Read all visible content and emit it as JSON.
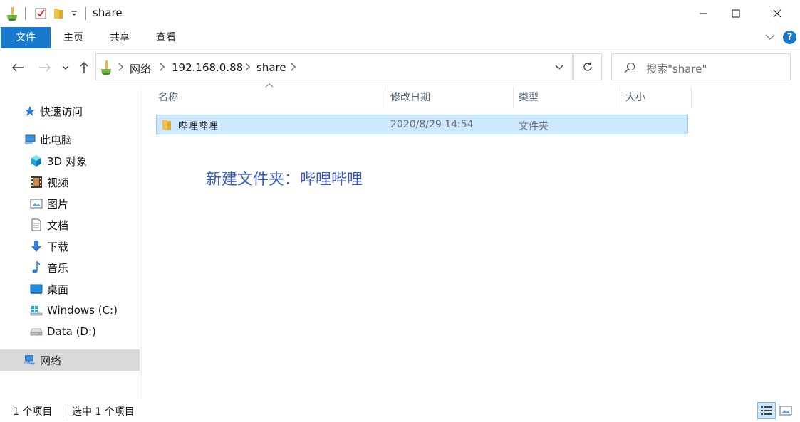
{
  "window": {
    "title": "share",
    "controls": [
      "minimize-icon",
      "maximize-icon",
      "close-icon"
    ]
  },
  "quick_access_toolbar": {
    "icons": [
      "properties-icon",
      "new-folder-icon",
      "customize-dropdown-icon"
    ]
  },
  "ribbon": {
    "tabs": [
      {
        "label": "文件",
        "active": true
      },
      {
        "label": "主页"
      },
      {
        "label": "共享"
      },
      {
        "label": "查看"
      }
    ],
    "expand_icon": "chevron-down-icon",
    "help_icon": "help-icon",
    "accent": "#1979ca"
  },
  "address_bar": {
    "crumbs": [
      "网络",
      "192.168.0.88",
      "share"
    ],
    "search_placeholder": "搜索\"share\""
  },
  "sidebar": {
    "items": [
      {
        "label": "快速访问",
        "icon": "star-icon"
      },
      {
        "label": "此电脑",
        "icon": "computer-icon"
      },
      {
        "label": "3D 对象",
        "icon": "cube-icon"
      },
      {
        "label": "视频",
        "icon": "video-icon"
      },
      {
        "label": "图片",
        "icon": "picture-icon"
      },
      {
        "label": "文档",
        "icon": "document-icon"
      },
      {
        "label": "下载",
        "icon": "download-icon"
      },
      {
        "label": "音乐",
        "icon": "music-icon"
      },
      {
        "label": "桌面",
        "icon": "desktop-icon"
      },
      {
        "label": "Windows (C:)",
        "icon": "drive-c-icon"
      },
      {
        "label": "Data (D:)",
        "icon": "drive-d-icon"
      },
      {
        "label": "网络",
        "icon": "network-icon",
        "selected": true
      }
    ]
  },
  "columns": [
    "名称",
    "修改日期",
    "类型",
    "大小"
  ],
  "files": [
    {
      "name": "哔哩哔哩",
      "modified": "2020/8/29 14:54",
      "type": "文件夹",
      "size": "",
      "selected": true
    }
  ],
  "annotation": "新建文件夹：哔哩哔哩",
  "status": {
    "count": "1 个项目",
    "selected": "选中 1 个项目"
  }
}
